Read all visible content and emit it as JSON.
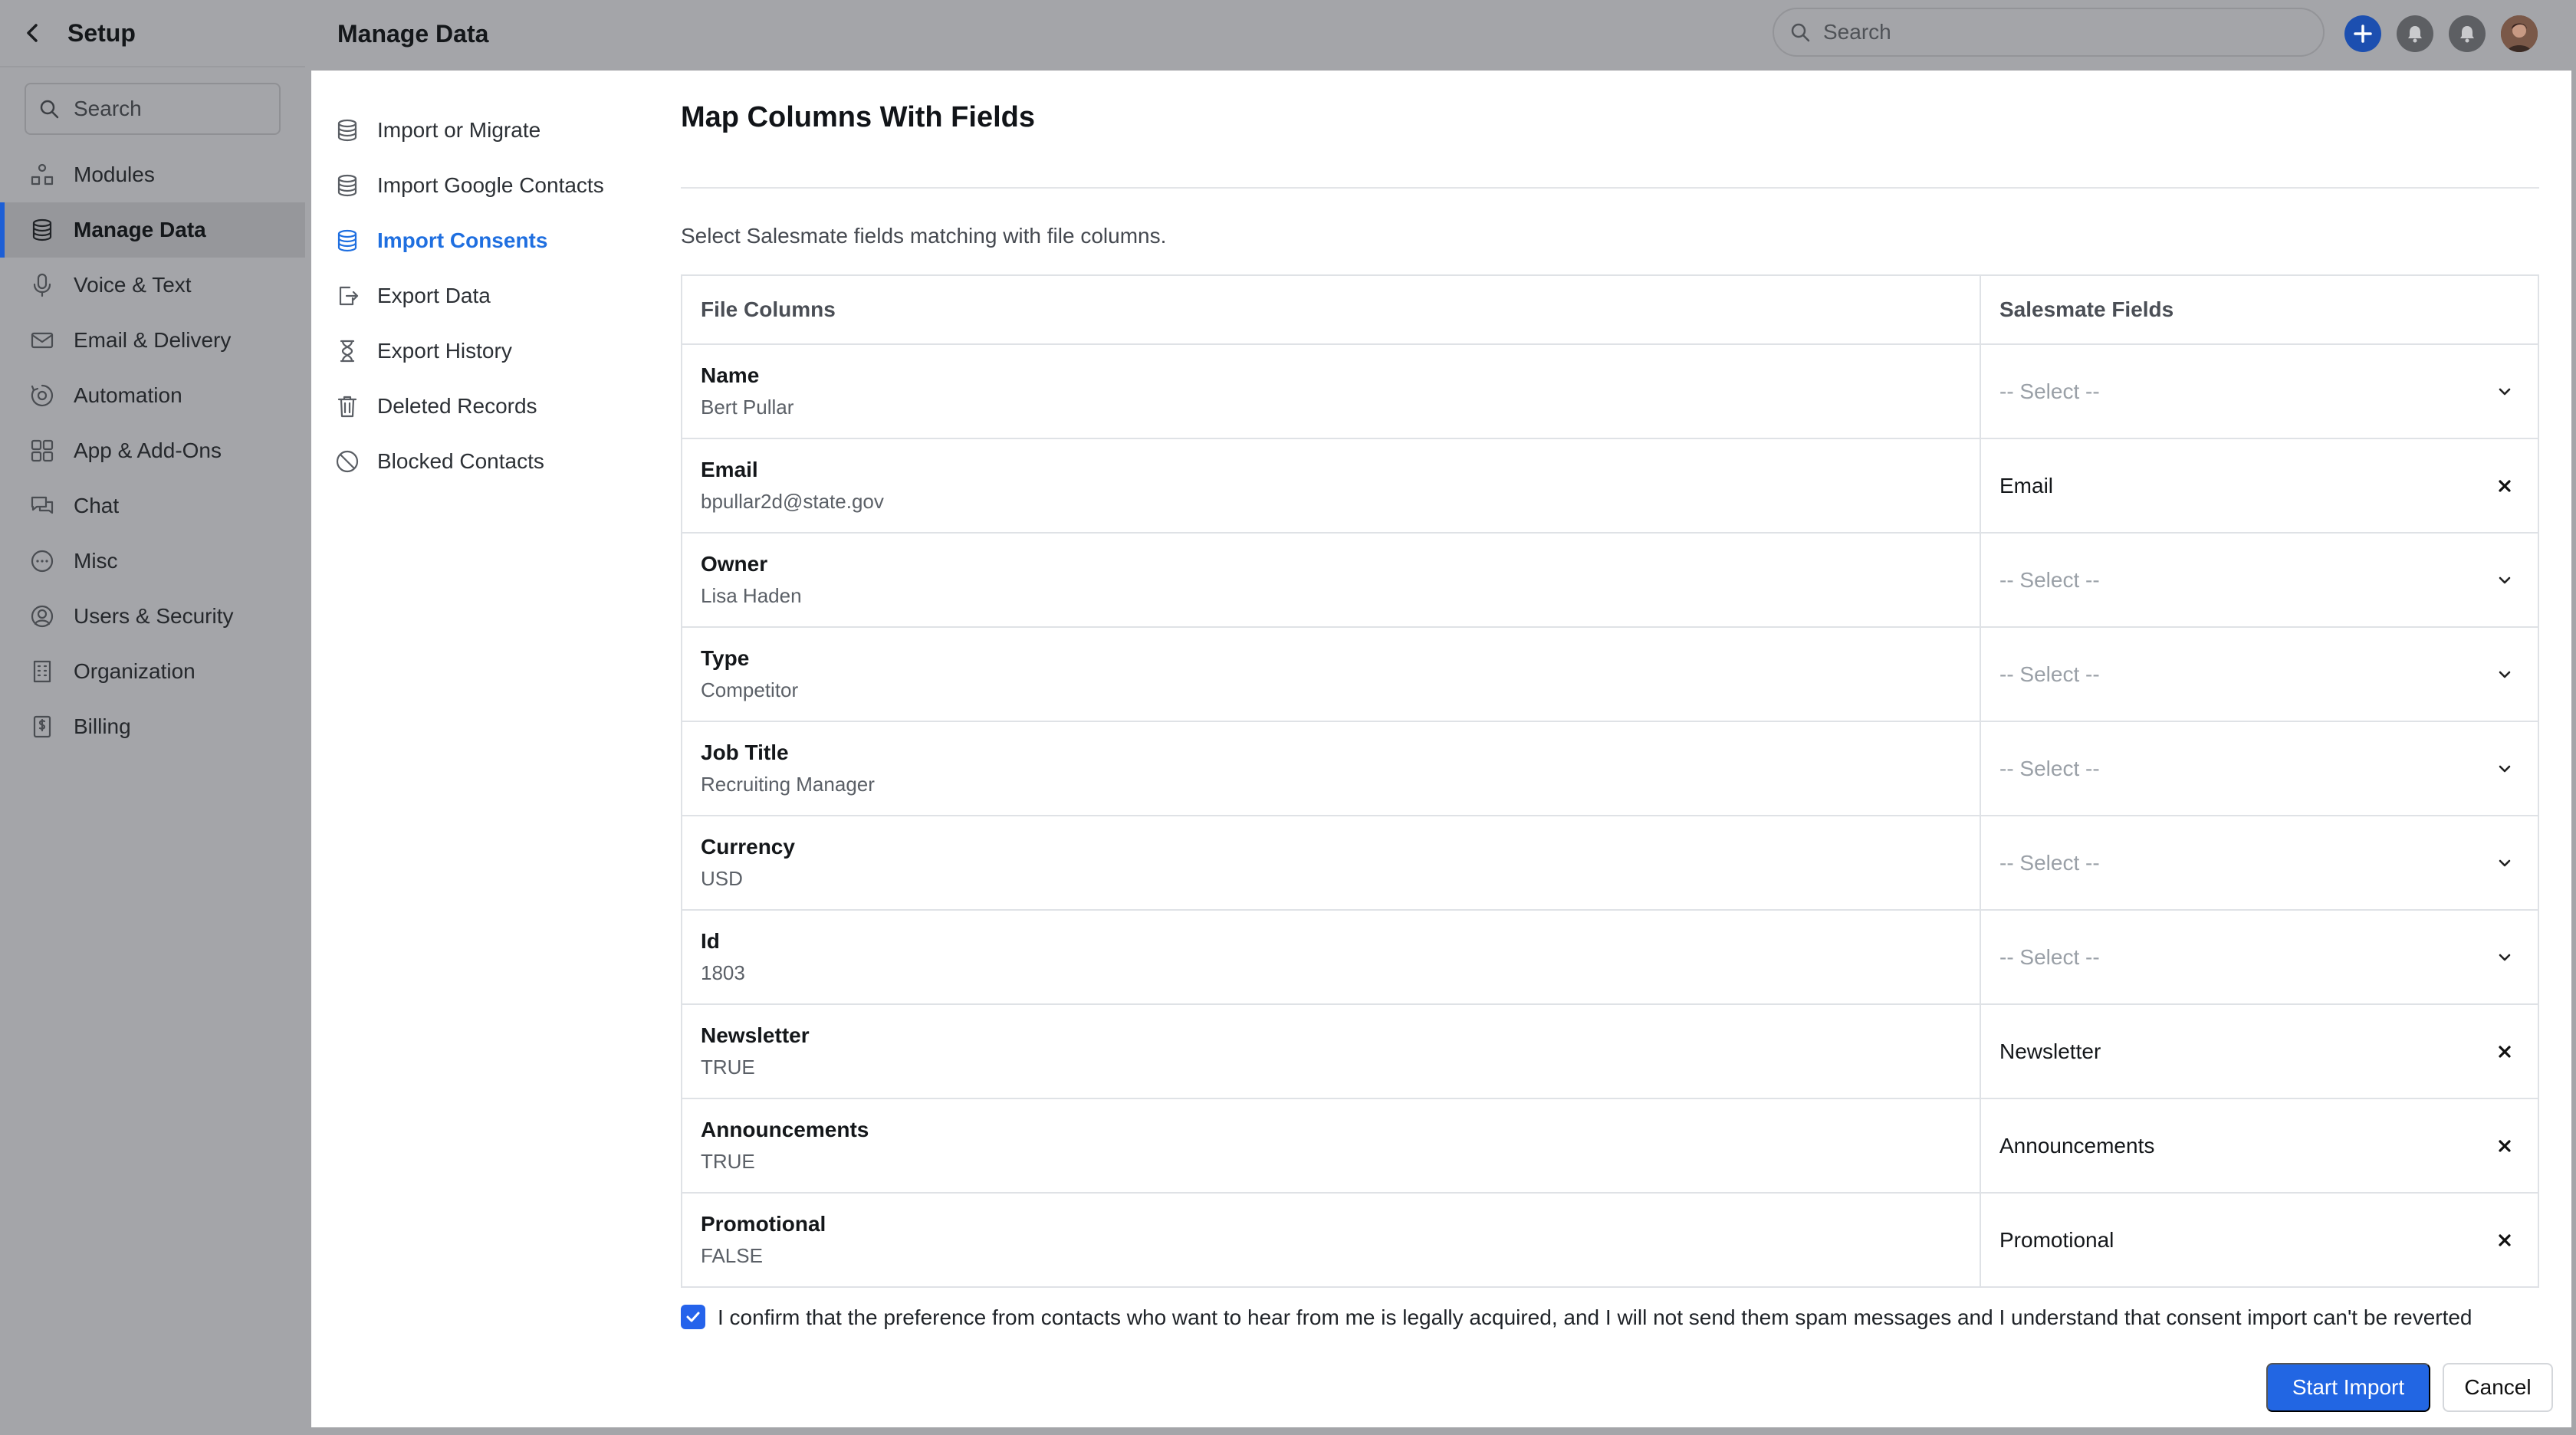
{
  "setup": {
    "title": "Setup",
    "search_placeholder": "Search",
    "nav": [
      {
        "label": "Modules",
        "icon": "modules-icon"
      },
      {
        "label": "Manage Data",
        "icon": "database-icon",
        "active": true
      },
      {
        "label": "Voice & Text",
        "icon": "microphone-icon"
      },
      {
        "label": "Email & Delivery",
        "icon": "envelope-icon"
      },
      {
        "label": "Automation",
        "icon": "automation-icon"
      },
      {
        "label": "App & Add-Ons",
        "icon": "apps-grid-icon"
      },
      {
        "label": "Chat",
        "icon": "chat-icon"
      },
      {
        "label": "Misc",
        "icon": "ellipsis-circle-icon"
      },
      {
        "label": "Users & Security",
        "icon": "user-circle-icon"
      },
      {
        "label": "Organization",
        "icon": "building-icon"
      },
      {
        "label": "Billing",
        "icon": "invoice-icon"
      }
    ]
  },
  "topbar": {
    "title": "Manage Data",
    "search_placeholder": "Search"
  },
  "subnav": [
    {
      "label": "Import or Migrate",
      "icon": "database-icon"
    },
    {
      "label": "Import Google Contacts",
      "icon": "database-icon"
    },
    {
      "label": "Import Consents",
      "icon": "database-icon",
      "active": true
    },
    {
      "label": "Export Data",
      "icon": "export-icon"
    },
    {
      "label": "Export History",
      "icon": "hourglass-icon"
    },
    {
      "label": "Deleted Records",
      "icon": "trash-icon"
    },
    {
      "label": "Blocked Contacts",
      "icon": "blocked-icon"
    }
  ],
  "page": {
    "heading": "Map Columns With Fields",
    "instruction": "Select Salesmate fields matching with file columns."
  },
  "table": {
    "headers": {
      "file": "File Columns",
      "fields": "Salesmate Fields"
    },
    "placeholder": "-- Select --",
    "rows": [
      {
        "name": "Name",
        "sample": "Bert Pullar",
        "mapped": ""
      },
      {
        "name": "Email",
        "sample": "bpullar2d@state.gov",
        "mapped": "Email"
      },
      {
        "name": "Owner",
        "sample": "Lisa Haden",
        "mapped": ""
      },
      {
        "name": "Type",
        "sample": "Competitor",
        "mapped": ""
      },
      {
        "name": "Job Title",
        "sample": "Recruiting Manager",
        "mapped": ""
      },
      {
        "name": "Currency",
        "sample": "USD",
        "mapped": ""
      },
      {
        "name": "Id",
        "sample": "1803",
        "mapped": ""
      },
      {
        "name": "Newsletter",
        "sample": "TRUE",
        "mapped": "Newsletter"
      },
      {
        "name": "Announcements",
        "sample": "TRUE",
        "mapped": "Announcements"
      },
      {
        "name": "Promotional",
        "sample": "FALSE",
        "mapped": "Promotional"
      }
    ]
  },
  "confirm": {
    "checked": true,
    "text": "I confirm that the preference from contacts who want to hear from me is legally acquired, and I will not send them spam messages and I understand that consent import can't be reverted"
  },
  "actions": {
    "start": "Start Import",
    "cancel": "Cancel"
  },
  "colors": {
    "accent": "#2266e3",
    "active_link": "#1f6fe0"
  }
}
